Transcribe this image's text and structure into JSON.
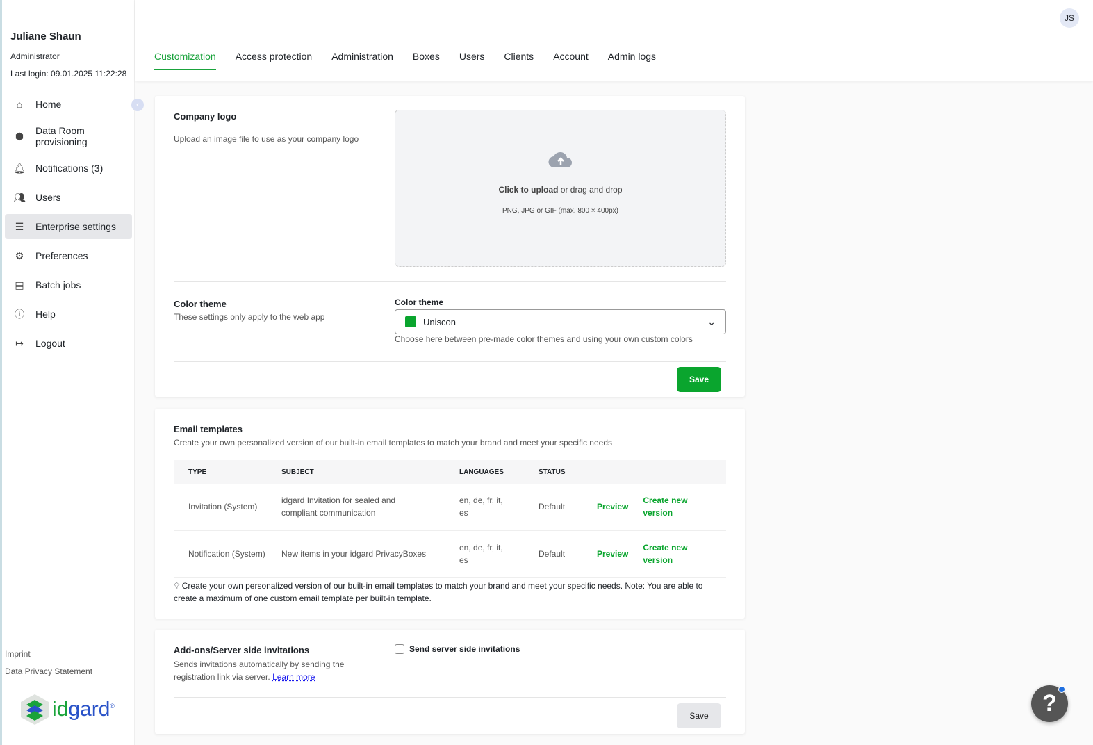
{
  "user": {
    "name": "Juliane Shaun",
    "role": "Administrator",
    "last_login": "Last login: 09.01.2025 11:22:28",
    "initials": "JS"
  },
  "nav": [
    {
      "label": "Home",
      "icon": "home-icon"
    },
    {
      "label": "Data Room provisioning",
      "icon": "cube-icon"
    },
    {
      "label": "Notifications (3)",
      "icon": "bell-icon"
    },
    {
      "label": "Users",
      "icon": "users-icon"
    },
    {
      "label": "Enterprise settings",
      "icon": "sliders-icon"
    },
    {
      "label": "Preferences",
      "icon": "gear-icon"
    },
    {
      "label": "Batch jobs",
      "icon": "server-icon"
    },
    {
      "label": "Help",
      "icon": "info-icon"
    },
    {
      "label": "Logout",
      "icon": "logout-icon"
    }
  ],
  "footer": {
    "imprint": "Imprint",
    "privacy": "Data Privacy Statement",
    "logo": "idgard"
  },
  "tabs": [
    "Customization",
    "Access protection",
    "Administration",
    "Boxes",
    "Users",
    "Clients",
    "Account",
    "Admin logs"
  ],
  "logo_section": {
    "title": "Company logo",
    "desc": "Upload an image file to use as your company logo",
    "upload_bold": "Click to upload",
    "upload_rest": " or drag and drop",
    "formats": "PNG, JPG or GIF (max. 800 × 400px)"
  },
  "theme": {
    "title": "Color theme",
    "desc": "These settings only apply to the web app",
    "label": "Color theme",
    "value": "Uniscon",
    "color": "#0aa52e",
    "hint": "Choose here between pre-made color themes and using your own custom colors",
    "save": "Save"
  },
  "email": {
    "title": "Email templates",
    "desc": "Create your own personalized version of our built-in email templates to match your brand and meet your specific needs",
    "headers": [
      "TYPE",
      "SUBJECT",
      "LANGUAGES",
      "STATUS"
    ],
    "rows": [
      {
        "type": "Invitation (System)",
        "subject": "idgard Invitation for sealed and compliant communication",
        "languages": "en, de, fr, it, es",
        "status": "Default",
        "preview": "Preview",
        "create": "Create new version"
      },
      {
        "type": "Notification (System)",
        "subject": "New items in your idgard PrivacyBoxes",
        "languages": "en, de, fr, it, es",
        "status": "Default",
        "preview": "Preview",
        "create": "Create new version"
      }
    ],
    "note": "Create your own personalized version of our built-in email templates to match your brand and meet your specific needs. Note: You are able to create a maximum of one custom email template per built-in template."
  },
  "addons": {
    "title": "Add-ons/Server side invitations",
    "desc": "Sends invitations automatically by sending the registration link via server.",
    "learn_more": "Learn more",
    "checkbox": "Send server side invitations",
    "save": "Save"
  }
}
